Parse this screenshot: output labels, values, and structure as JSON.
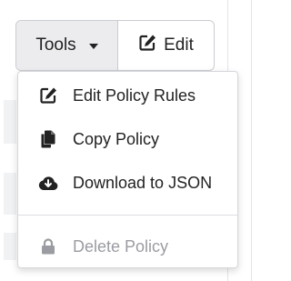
{
  "toolbar": {
    "tools_label": "Tools",
    "edit_label": "Edit"
  },
  "menu": {
    "items": [
      {
        "label": "Edit Policy Rules",
        "icon": "edit-icon",
        "disabled": false
      },
      {
        "label": "Copy Policy",
        "icon": "copy-icon",
        "disabled": false
      },
      {
        "label": "Download to JSON",
        "icon": "cloud-download-icon",
        "disabled": false
      },
      {
        "label": "Delete Policy",
        "icon": "lock-icon",
        "disabled": true
      }
    ]
  },
  "colors": {
    "text": "#222222",
    "disabled_text": "#9a9ca1",
    "tools_button_bg": "#ececee",
    "border": "#c9ccd1"
  }
}
